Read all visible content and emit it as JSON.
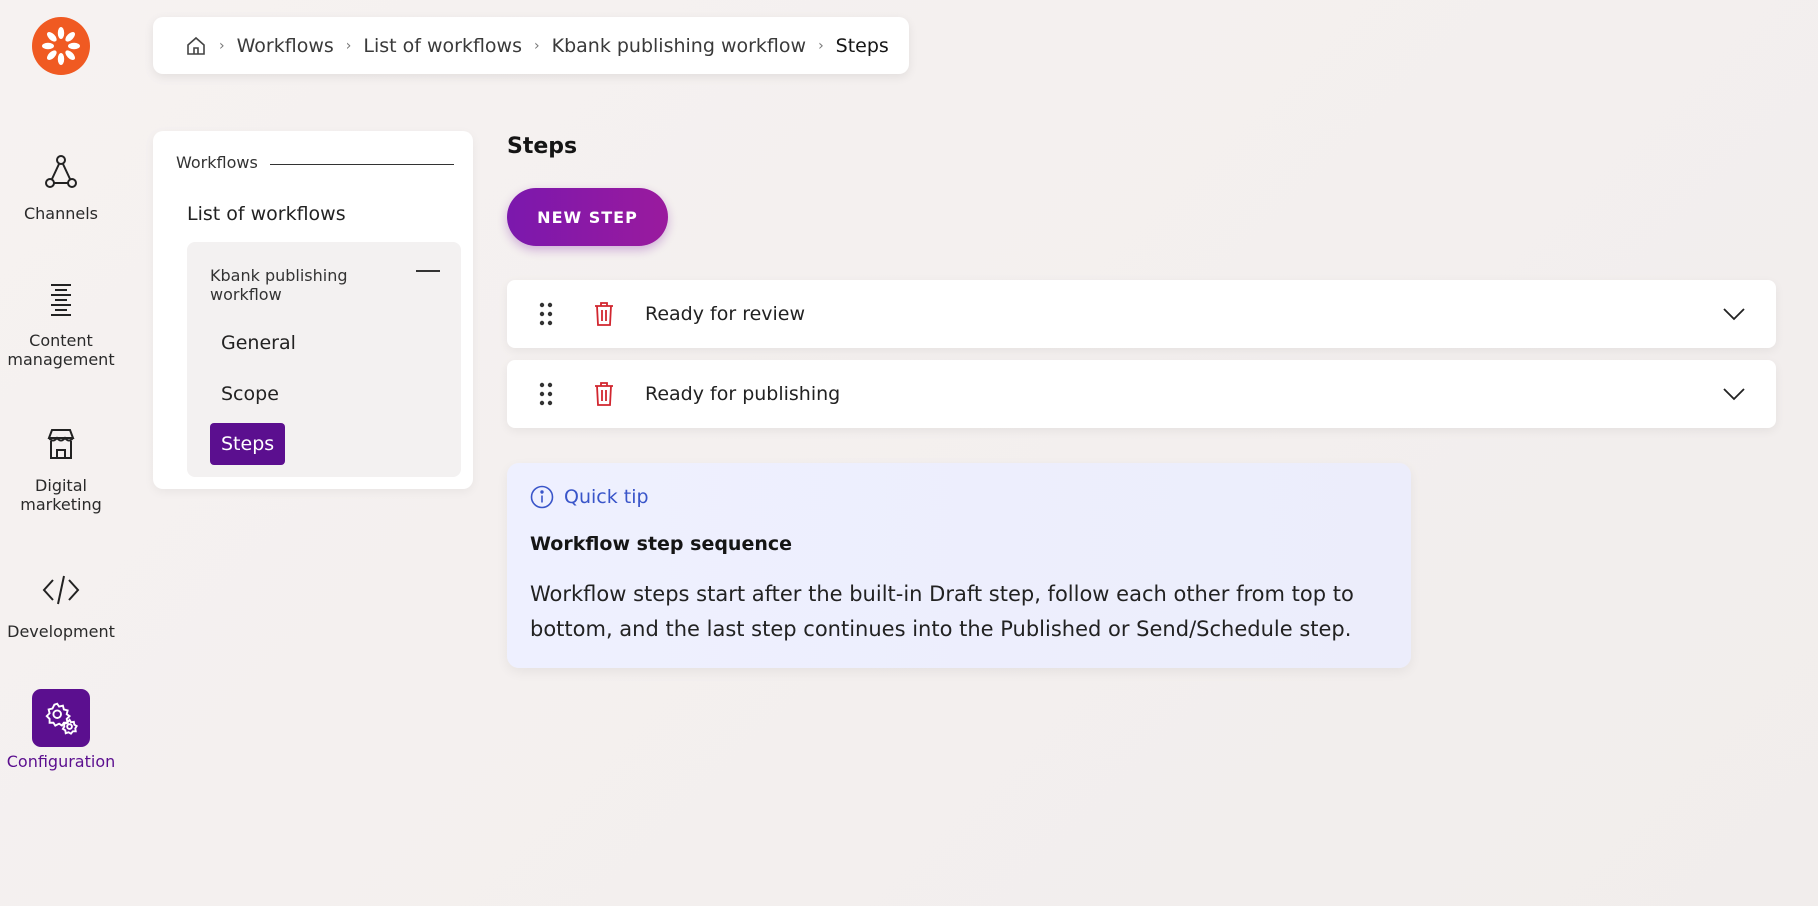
{
  "nav": {
    "items": [
      {
        "label": "Channels",
        "icon": "channels-icon"
      },
      {
        "label": "Content\nmanagement",
        "icon": "content-management-icon"
      },
      {
        "label": "Digital\nmarketing",
        "icon": "digital-marketing-icon"
      },
      {
        "label": "Development",
        "icon": "code-icon"
      },
      {
        "label": "Configuration",
        "icon": "gear-icon",
        "active": true
      }
    ]
  },
  "breadcrumb": {
    "items": [
      "Workflows",
      "List of workflows",
      "Kbank publishing workflow",
      "Steps"
    ]
  },
  "panel": {
    "heading": "Workflows",
    "list_link": "List of workflows",
    "group_title": "Kbank publishing workflow",
    "sub_items": [
      "General",
      "Scope",
      "Steps"
    ],
    "active_sub_item": "Steps"
  },
  "main": {
    "title": "Steps",
    "new_step_label": "NEW STEP",
    "steps": [
      "Ready for review",
      "Ready for publishing"
    ]
  },
  "tip": {
    "label": "Quick tip",
    "title": "Workflow step sequence",
    "body": "Workflow steps start after the built-in Draft step, follow each other from top to bottom, and the last step continues into the Published or Send/Schedule step."
  },
  "colors": {
    "brand_orange": "#f05a22",
    "accent_purple": "#5b0f8f",
    "delete_red": "#d1262f",
    "tip_blue": "#3955c9"
  }
}
